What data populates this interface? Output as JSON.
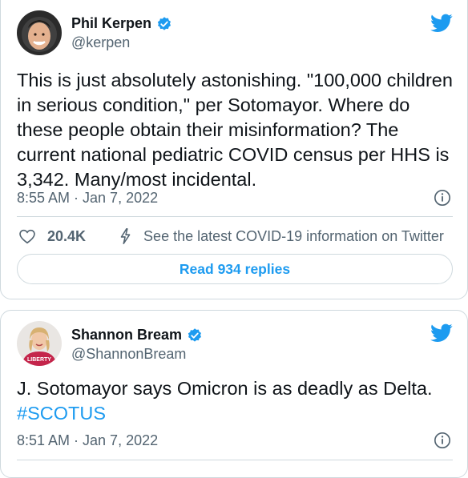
{
  "tweets": [
    {
      "author_name": "Phil Kerpen",
      "handle": "@kerpen",
      "text": "This is just absolutely astonishing.  \"100,000 children\nin serious condition,\" per Sotomayor.  Where do\nthese people obtain their misinformation?  The\ncurrent national pediatric COVID census per HHS is\n3,342.  Many/most incidental.",
      "timestamp": "8:55 AM · Jan 7, 2022",
      "like_count": "20.4K",
      "covid_link": "See the latest COVID-19 information on Twitter",
      "replies_label": "Read 934 replies"
    },
    {
      "author_name": "Shannon Bream",
      "handle": "@ShannonBream",
      "text_plain": "J. Sotomayor says Omicron is as deadly as Delta.",
      "hashtag": "#SCOTUS",
      "timestamp": "8:51 AM · Jan 7, 2022"
    }
  ],
  "icons": {
    "verified": "verified-badge-icon",
    "twitter_logo": "twitter-bird-icon",
    "info": "info-icon",
    "like": "heart-icon",
    "covid": "bolt-icon"
  },
  "colors": {
    "accent": "#1d9bf0",
    "text": "#0f1419",
    "muted": "#536471",
    "border": "#cfd9de"
  }
}
